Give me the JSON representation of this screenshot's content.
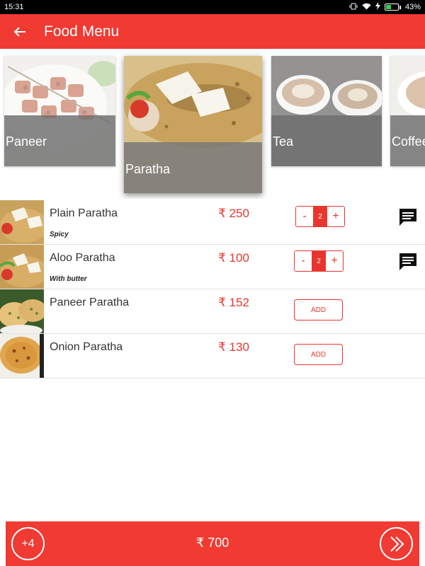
{
  "status_bar": {
    "time": "15:31",
    "battery": "43%",
    "battery_level": 0.43,
    "icons": [
      "vibrate-icon",
      "wifi-icon",
      "charging-icon",
      "battery-icon"
    ]
  },
  "app_bar": {
    "title": "Food Menu",
    "back_icon": "arrow-left-icon",
    "color": "#f03a32"
  },
  "categories": [
    {
      "label": "Paneer",
      "selected": false
    },
    {
      "label": "Paratha",
      "selected": true
    },
    {
      "label": "Tea",
      "selected": false
    },
    {
      "label": "Coffee",
      "selected": false
    }
  ],
  "items": [
    {
      "name": "Plain Paratha",
      "note": "Spicy",
      "price": "₹ 250",
      "quantity": "2",
      "has_comment": true
    },
    {
      "name": "Aloo Paratha",
      "note": "With butter",
      "price": "₹ 100",
      "quantity": "2",
      "has_comment": true
    },
    {
      "name": "Paneer Paratha",
      "note": "",
      "price": "₹ 152",
      "add_label": "ADD",
      "has_comment": false
    },
    {
      "name": "Onion Paratha",
      "note": "",
      "price": "₹ 130",
      "add_label": "ADD",
      "has_comment": false
    }
  ],
  "stepper": {
    "minus": "-",
    "plus": "+"
  },
  "cart": {
    "count": "+4",
    "total": "₹ 700",
    "next_icon": "double-chevron-right-icon"
  },
  "colors": {
    "accent": "#f03a32",
    "price": "#e8362e"
  }
}
